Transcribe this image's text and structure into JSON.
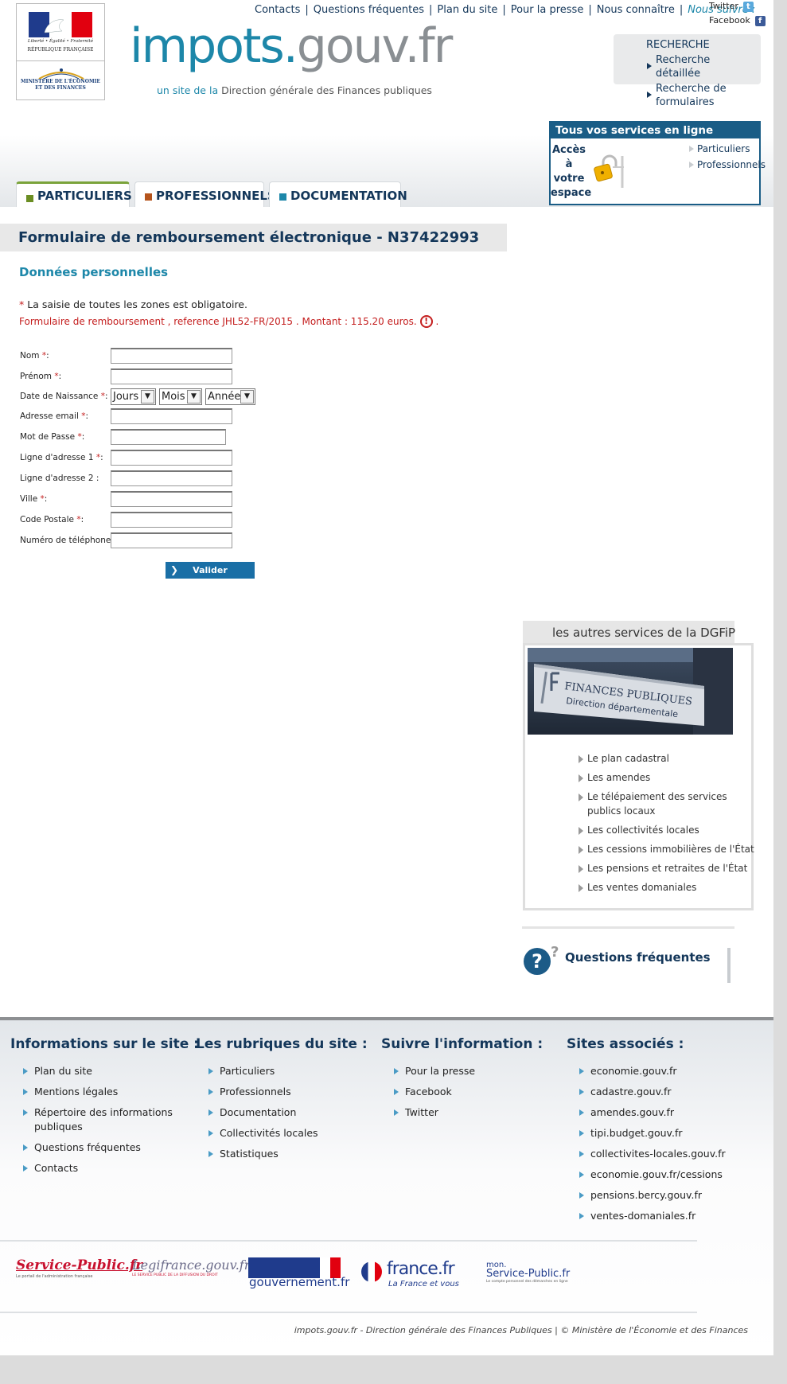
{
  "header": {
    "logo_motto": "Liberté • Égalité • Fraternité",
    "logo_republic": "RÉPUBLIQUE FRANÇAISE",
    "logo_ministry": "MINISTÈRE DE L'ÉCONOMIE ET DES FINANCES",
    "site_name_part1": "impots.",
    "site_name_part2": "gouv.fr",
    "tagline_part1": "un site de la ",
    "tagline_part2": "Direction générale des Finances publiques",
    "top_links": [
      "Contacts",
      "Questions fréquentes",
      "Plan du site",
      "Pour la presse",
      "Nous connaître"
    ],
    "follow_label": "Nous suivre :",
    "social": {
      "twitter": "Twitter",
      "facebook": "Facebook"
    },
    "search": {
      "title": "RECHERCHE",
      "links": [
        "Recherche détaillée",
        "Recherche de formulaires"
      ]
    },
    "services": {
      "title": "Tous vos services en ligne",
      "access_label": "Accès à votre espace",
      "links": [
        "Particuliers",
        "Professionnels"
      ]
    },
    "tabs": [
      {
        "label": "PARTICULIERS",
        "color": "#6b8e23"
      },
      {
        "label": "PROFESSIONNELS",
        "color": "#b5541c"
      },
      {
        "label": "DOCUMENTATION",
        "color": "#1d87a9"
      }
    ]
  },
  "form": {
    "page_title": "Formulaire de remboursement électronique - N37422993",
    "section_title": "Données personnelles",
    "required_star": "*",
    "required_note": " La saisie de toutes les zones est obligatoire.",
    "alert_text": "Formulaire de remboursement , reference JHL52-FR/2015 . Montant : 115.20 euros.",
    "alert_icon": "!",
    "alert_suffix": " .",
    "fields": [
      {
        "label": "Nom",
        "required": "*",
        "suffix": ":"
      },
      {
        "label": "Prénom",
        "required": "*",
        "suffix": ":"
      },
      {
        "label": "Date de Naissance",
        "required": "*",
        "suffix": ":"
      },
      {
        "label": "Adresse email",
        "required": "*",
        "suffix": ":"
      },
      {
        "label": "Mot de Passe",
        "required": "*",
        "suffix": ":"
      },
      {
        "label": "Ligne d'adresse 1",
        "required": "*",
        "suffix": ":"
      },
      {
        "label": "Ligne d'adresse 2",
        "required": "",
        "suffix": ":"
      },
      {
        "label": "Ville",
        "required": "*",
        "suffix": ":"
      },
      {
        "label": "Code Postale",
        "required": "*",
        "suffix": ":"
      },
      {
        "label": "Numéro de téléphone",
        "required": "*",
        "suffix": ":"
      }
    ],
    "birth_selects": {
      "day": "Jours",
      "month": "Mois",
      "year": "Année"
    },
    "submit_label": "Valider"
  },
  "sidebar": {
    "dgfip_title": "les autres services de la DGFiP",
    "photo_sign_line1": "FINANCES PUBLIQUES",
    "photo_sign_line2": "Direction départementale",
    "dgfip_links": [
      "Le plan cadastral",
      "Les amendes",
      "Le télépaiement des services publics locaux",
      "Les collectivités locales",
      "Les cessions immobilières de l'État",
      "Les pensions et retraites de l'État",
      "Les ventes domaniales"
    ],
    "faq_label": "Questions fréquentes"
  },
  "footer": {
    "columns": [
      {
        "title": "Informations sur le site :",
        "links": [
          "Plan du site",
          "Mentions légales",
          "Répertoire des informations publiques",
          "Questions fréquentes",
          "Contacts"
        ]
      },
      {
        "title": "Les rubriques du site :",
        "links": [
          "Particuliers",
          "Professionnels",
          "Documentation",
          "Collectivités locales",
          "Statistiques"
        ]
      },
      {
        "title": "Suivre l'information :",
        "links": [
          "Pour la presse",
          "Facebook",
          "Twitter"
        ]
      },
      {
        "title": "Sites associés :",
        "links": [
          "economie.gouv.fr",
          "cadastre.gouv.fr",
          "amendes.gouv.fr",
          "tipi.budget.gouv.fr",
          "collectivites-locales.gouv.fr",
          "economie.gouv.fr/cessions",
          "pensions.bercy.gouv.fr",
          "ventes-domaniales.fr"
        ]
      }
    ],
    "partners": {
      "service_public": "Service-Public.fr",
      "service_public_sub": "Le portail de l'administration française",
      "legifrance": "Legifrance.gouv.fr",
      "legifrance_sub": "LE SERVICE PUBLIC DE LA DIFFUSION DU DROIT",
      "gouvernement": "gouvernement.fr",
      "france": "france.fr",
      "france_sub": "La France et vous",
      "mon_sp_1": "mon.",
      "mon_sp_2": "Service-Public.fr",
      "mon_sp_sub": "Le compte personnel des démarches en ligne"
    },
    "copyright": "impots.gouv.fr - Direction générale des Finances Publiques | © Ministère de l'Économie et des Finances"
  }
}
